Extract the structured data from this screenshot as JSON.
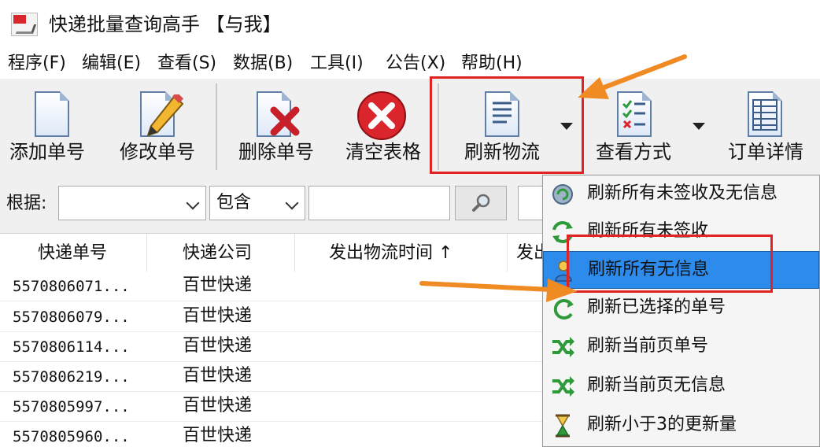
{
  "window": {
    "title": "快递批量查询高手 【与我】"
  },
  "menu": [
    "程序(F)",
    "编辑(E)",
    "查看(S)",
    "数据(B)",
    "工具(I)",
    "公告(X)",
    "帮助(H)"
  ],
  "toolbar": {
    "add": "添加单号",
    "edit": "修改单号",
    "delete": "删除单号",
    "clear": "清空表格",
    "refresh": "刷新物流",
    "view": "查看方式",
    "detail": "订单详情"
  },
  "filter": {
    "label": "根据:",
    "field_value": "",
    "match_value": "包含",
    "query_value": ""
  },
  "table": {
    "headers": [
      "快递单号",
      "快递公司",
      "发出物流时间 ↑",
      "发出"
    ],
    "rows": [
      {
        "number": "5570806071...",
        "company": "百世快递"
      },
      {
        "number": "5570806079...",
        "company": "百世快递"
      },
      {
        "number": "5570806114...",
        "company": "百世快递"
      },
      {
        "number": "5570806219...",
        "company": "百世快递"
      },
      {
        "number": "5570805997...",
        "company": "百世快递"
      },
      {
        "number": "5570805960...",
        "company": "百世快递"
      }
    ]
  },
  "refresh_menu": {
    "items": [
      "刷新所有未签收及无信息",
      "刷新所有未签收",
      "刷新所有无信息",
      "刷新已选择的单号",
      "刷新当前页单号",
      "刷新当前页无信息",
      "刷新小于3的更新量"
    ],
    "selected": "刷新所有无信息"
  },
  "colors": {
    "highlight": "#e02323",
    "arrow": "#f08a22",
    "selection": "#2d8ceb"
  }
}
